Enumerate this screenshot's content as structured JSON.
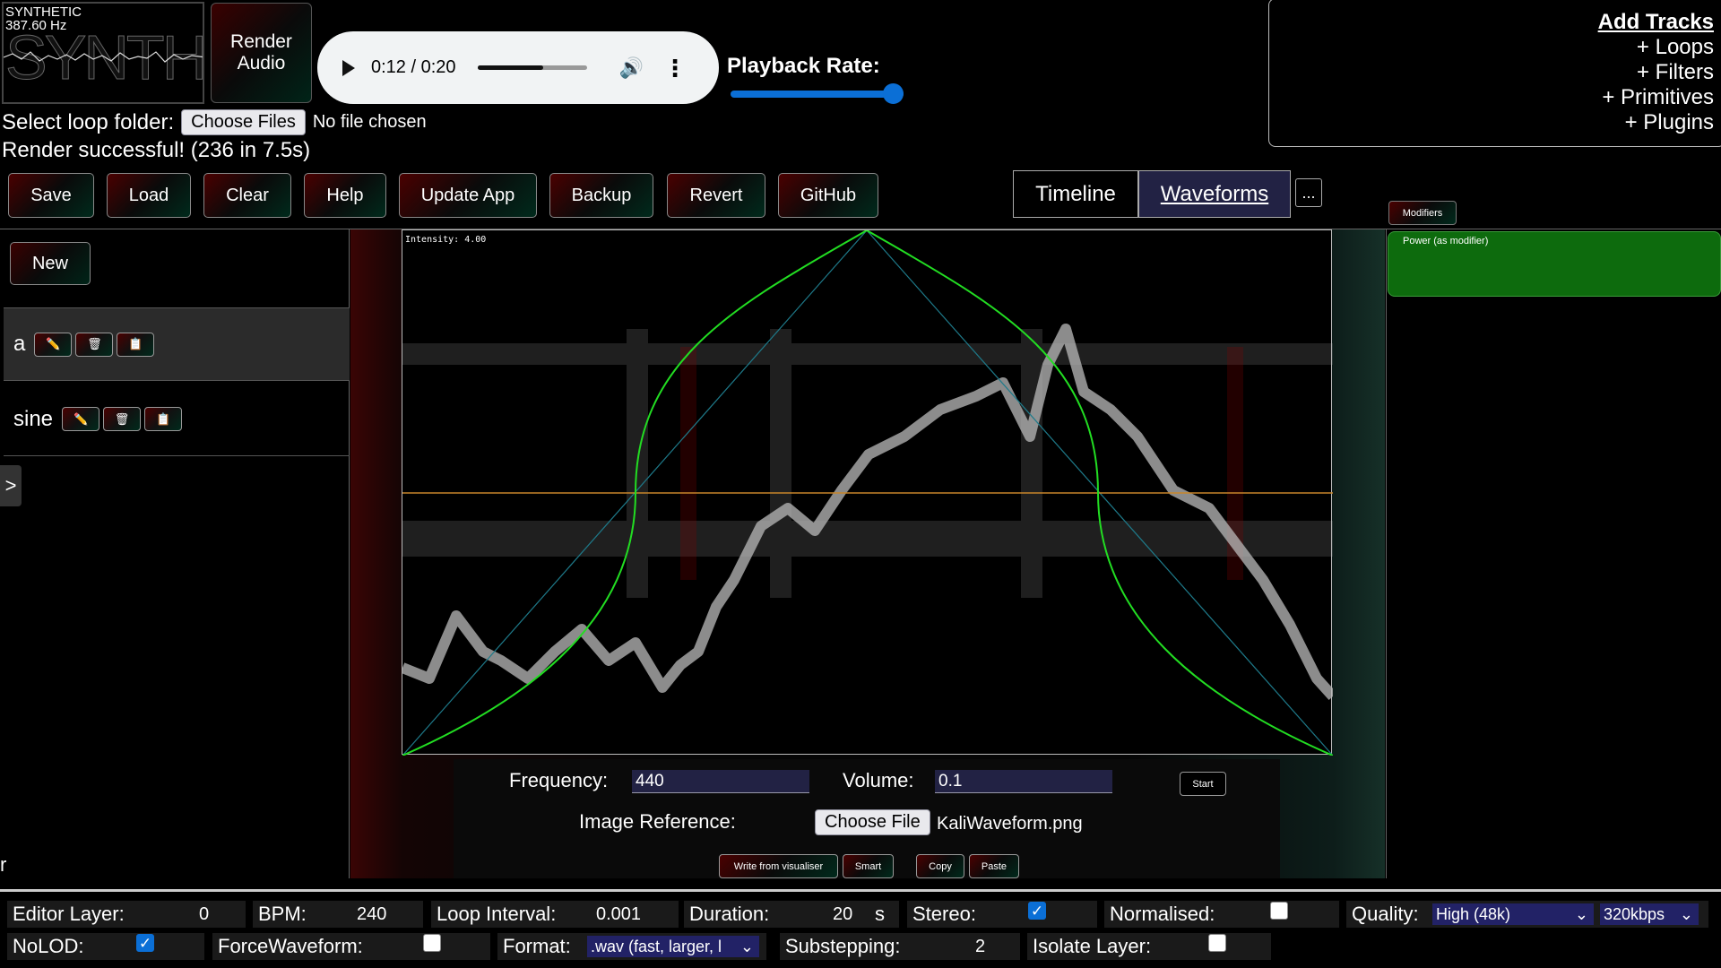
{
  "header": {
    "logo_title": "SYNTHETIC",
    "logo_freq": "387.60 Hz",
    "logo_big": "SYNTHETIC",
    "render_button": "Render Audio",
    "player": {
      "time": "0:12 / 0:20",
      "progress": 0.6,
      "volume_icon": "🔊",
      "more_icon": "⋮"
    },
    "playback_rate_label": "Playback Rate:",
    "playback_rate_value": 1.0
  },
  "add_tracks": {
    "heading": "Add Tracks",
    "items": [
      "+ Loops",
      "+ Filters",
      "+ Primitives",
      "+ Plugins"
    ]
  },
  "loop_folder": {
    "label": "Select loop folder:",
    "button": "Choose Files",
    "file_status": "No file chosen"
  },
  "render_status": "Render successful! (236 in 7.5s)",
  "toolbar": {
    "buttons": [
      "Save",
      "Load",
      "Clear",
      "Help",
      "Update App",
      "Backup",
      "Revert",
      "GitHub"
    ]
  },
  "tabs": {
    "timeline": "Timeline",
    "waveforms": "Waveforms",
    "more": "..."
  },
  "modifiers_button": "Modifiers",
  "left_panel": {
    "new_button": "New",
    "waveforms": [
      {
        "name": "a",
        "selected": true
      },
      {
        "name": "sine",
        "selected": false
      }
    ],
    "expand": ">",
    "stray_text": "r"
  },
  "visualiser": {
    "intensity_label": "Intensity: 4.00",
    "frequency_label": "Frequency:",
    "frequency_value": "440",
    "volume_label": "Volume:",
    "volume_value": "0.1",
    "start_button": "Start",
    "image_ref_label": "Image Reference:",
    "image_ref_button": "Choose File",
    "image_ref_file": "KaliWaveform.png",
    "buttons": [
      "Write from visualiser",
      "Smart",
      "Copy",
      "Paste"
    ],
    "colors": {
      "curve": "#22dd22",
      "guide": "#1e7a8a",
      "centerline": "#c8862a"
    }
  },
  "modifiers_panel": {
    "card_title": "Power (as modifier)"
  },
  "settings": {
    "editor_layer_label": "Editor Layer:",
    "editor_layer_value": "0",
    "bpm_label": "BPM:",
    "bpm_value": "240",
    "loop_interval_label": "Loop Interval:",
    "loop_interval_value": "0.001",
    "duration_label": "Duration:",
    "duration_value": "20",
    "duration_unit": "s",
    "stereo_label": "Stereo:",
    "stereo": true,
    "normalised_label": "Normalised:",
    "normalised": false,
    "quality_label": "Quality:",
    "quality_value": "High (48k)",
    "bitrate_value": "320kbps",
    "nolod_label": "NoLOD:",
    "nolod": true,
    "forcewaveform_label": "ForceWaveform:",
    "forcewaveform": false,
    "format_label": "Format:",
    "format_value": ".wav (fast, larger, l",
    "substepping_label": "Substepping:",
    "substepping_value": "2",
    "isolate_label": "Isolate Layer:",
    "isolate": false
  }
}
